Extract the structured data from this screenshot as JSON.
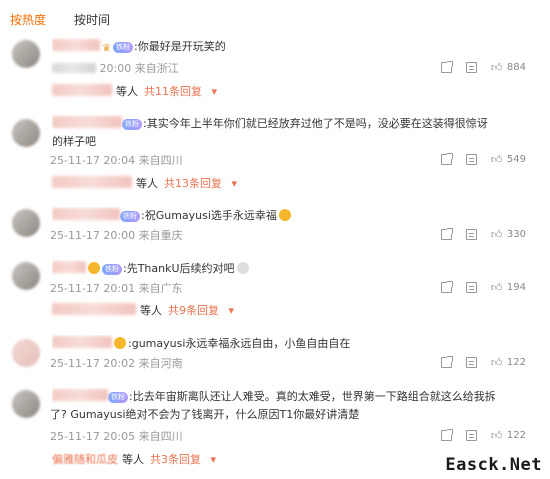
{
  "tabs": [
    {
      "label": "按热度",
      "active": true
    },
    {
      "label": "按时间",
      "active": false
    }
  ],
  "comments": [
    {
      "badge": "铁粉",
      "text": ":你最好是开玩笑的",
      "text2": "",
      "time": "20:00",
      "location": "来自浙江",
      "likes": "884",
      "reply_people": "等人",
      "reply_more": "共11条回复"
    },
    {
      "badge": "铁粉",
      "text": ":其实今年上半年你们就已经放弃过他了不是吗，没必要在这装得很惊讶",
      "text2": "的样子吧",
      "time": "25-11-17 20:04",
      "location": "来自四川",
      "likes": "549",
      "reply_people": "等人",
      "reply_more": "共13条回复"
    },
    {
      "badge": "铁粉",
      "text": ":祝Gumayusi选手永远幸福",
      "text2": "",
      "time": "25-11-17 20:00",
      "location": "来自重庆",
      "likes": "330",
      "reply_people": "",
      "reply_more": ""
    },
    {
      "badge": "铁粉",
      "text": ":先ThankU后续约对吧",
      "text2": "",
      "time": "25-11-17 20:01",
      "location": "来自广东",
      "likes": "194",
      "reply_people": "等人",
      "reply_more": "共9条回复"
    },
    {
      "badge": "",
      "text": ":gumayusi永远幸福永远自由，小鱼自由自在",
      "text2": "",
      "time": "25-11-17 20:02",
      "location": "来自河南",
      "likes": "122",
      "reply_people": "",
      "reply_more": ""
    },
    {
      "badge": "铁粉",
      "text": ":比去年宙斯离队还让人难受。真的太难受，世界第一下路组合就这么给我拆",
      "text2": "了? Gumayusi绝对不会为了钱离开，什么原因T1你最好讲清楚",
      "time": "25-11-17 20:05",
      "location": "来自四川",
      "likes": "122",
      "reply_people": "等人",
      "reply_more": "共3条回复",
      "reply_prefix": "偏雅随和瓜皮"
    }
  ],
  "watermark": "Easck.Net",
  "colors": {
    "accent": "#ff6d00",
    "reply_link": "#eb7350",
    "meta": "#999999"
  }
}
